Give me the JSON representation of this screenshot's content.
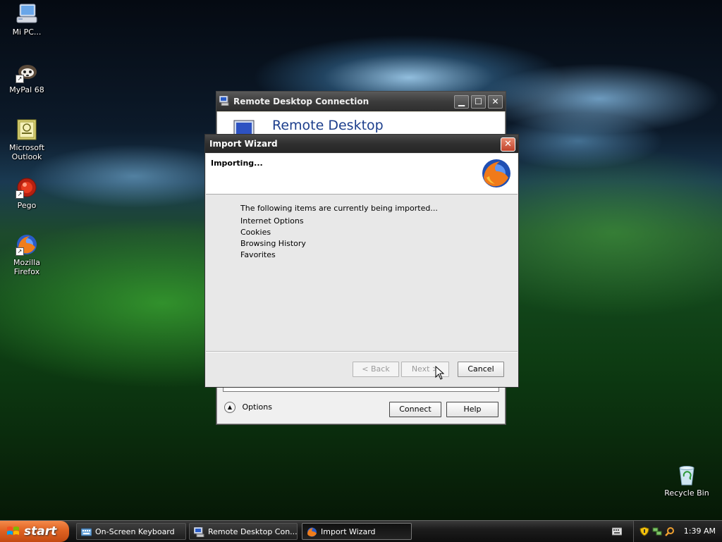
{
  "desktop": {
    "icons": [
      {
        "label": "Mi PC..."
      },
      {
        "label": "MyPal 68"
      },
      {
        "label": "Microsoft Outlook"
      },
      {
        "label": "Pego"
      },
      {
        "label": "Mozilla Firefox"
      },
      {
        "label": "Recycle Bin"
      }
    ]
  },
  "rdc_window": {
    "title": "Remote Desktop Connection",
    "banner_text": "Remote Desktop",
    "options_label": "Options",
    "connect_label": "Connect",
    "help_label": "Help"
  },
  "import_wizard": {
    "title": "Import Wizard",
    "heading": "Importing...",
    "intro": "The following items are currently being imported...",
    "items": [
      "Internet Options",
      "Cookies",
      "Browsing History",
      "Favorites"
    ],
    "back_label": "< Back",
    "next_label": "Next >",
    "cancel_label": "Cancel"
  },
  "taskbar": {
    "start_label": "start",
    "tasks": [
      {
        "label": "On-Screen Keyboard"
      },
      {
        "label": "Remote Desktop Con..."
      },
      {
        "label": "Import Wizard"
      }
    ],
    "clock": "1:39 AM"
  }
}
